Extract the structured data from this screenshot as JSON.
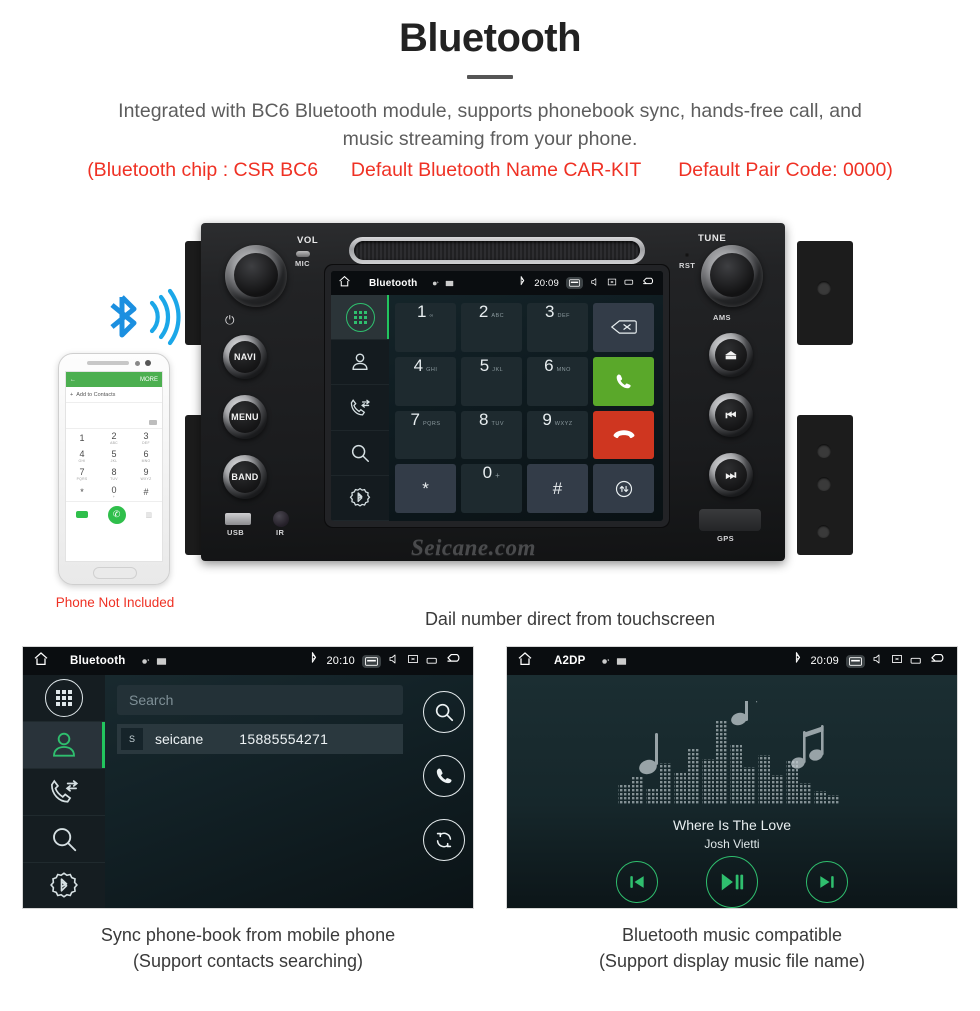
{
  "header": {
    "title": "Bluetooth",
    "subtitle_line1": "Integrated with BC6 Bluetooth module, supports phonebook sync, hands-free call, and",
    "subtitle_line2": "music streaming from your phone.",
    "note_chip": "(Bluetooth chip : CSR BC6",
    "note_name": "Default Bluetooth Name CAR-KIT",
    "note_pair": "Default Pair Code: 0000)",
    "accent_red": "#ef3124",
    "title_color": "#222222",
    "subtitle_color": "#5d5d5d"
  },
  "phone_mock": {
    "more_label": "MORE",
    "back_arrow": "←",
    "add_contacts": "Add to Contacts",
    "plus": "+",
    "keys": [
      {
        "num": "1",
        "sub": ""
      },
      {
        "num": "2",
        "sub": "ABC"
      },
      {
        "num": "3",
        "sub": "DEF"
      },
      {
        "num": "4",
        "sub": "GHI"
      },
      {
        "num": "5",
        "sub": "JKL"
      },
      {
        "num": "6",
        "sub": "MNO"
      },
      {
        "num": "7",
        "sub": "PQRS"
      },
      {
        "num": "8",
        "sub": "TUV"
      },
      {
        "num": "9",
        "sub": "WXYZ"
      },
      {
        "num": "*",
        "sub": ""
      },
      {
        "num": "0",
        "sub": "+"
      },
      {
        "num": "#",
        "sub": ""
      }
    ],
    "call_glyph": "✆",
    "not_included_label": "Phone Not Included"
  },
  "head_unit": {
    "vol_label": "VOL",
    "mic_label": "MIC",
    "power_glyph": "⏻",
    "tune_label": "TUNE",
    "rst_label": "RST",
    "ams_label": "AMS",
    "usb_label": "USB",
    "ir_label": "IR",
    "gps_label": "GPS",
    "watermark": "Seicane.com",
    "left_buttons": [
      "NAVI",
      "MENU",
      "BAND"
    ],
    "right_buttons": [
      {
        "name": "eject-button",
        "glyph": "⏏"
      },
      {
        "name": "previous-track-button",
        "glyph": "⏮"
      },
      {
        "name": "next-track-button",
        "glyph": "⏭"
      }
    ]
  },
  "main_screen": {
    "status": {
      "title": "Bluetooth",
      "time": "20:09",
      "home_icon": "home-icon",
      "bluetooth_icon": "bluetooth-icon",
      "keyboard_icon": "keyboard-icon",
      "mute_icon": "mute-icon",
      "close_icon": "close-window-icon",
      "window_icon": "window-icon",
      "back_icon": "back-arrow-icon"
    },
    "rail": [
      {
        "name": "sidebar-dialpad",
        "label": "dialpad-icon",
        "active": true
      },
      {
        "name": "sidebar-contacts",
        "label": "contacts-icon",
        "active": false
      },
      {
        "name": "sidebar-call-history",
        "label": "call-history-icon",
        "active": false
      },
      {
        "name": "sidebar-search",
        "label": "search-icon",
        "active": false
      },
      {
        "name": "sidebar-bt-settings",
        "label": "bluetooth-settings-icon",
        "active": false
      }
    ],
    "keypad": [
      {
        "type": "num",
        "num": "1",
        "sub": "∞"
      },
      {
        "type": "num",
        "num": "2",
        "sub": "ABC"
      },
      {
        "type": "num",
        "num": "3",
        "sub": "DEF"
      },
      {
        "type": "alt",
        "num": "⌫",
        "sub": "",
        "name": "backspace-key"
      },
      {
        "type": "num",
        "num": "4",
        "sub": "GHI"
      },
      {
        "type": "num",
        "num": "5",
        "sub": "JKL"
      },
      {
        "type": "num",
        "num": "6",
        "sub": "MNO"
      },
      {
        "type": "green",
        "num": "✆",
        "sub": "",
        "name": "call-key"
      },
      {
        "type": "num",
        "num": "7",
        "sub": "PQRS"
      },
      {
        "type": "num",
        "num": "8",
        "sub": "TUV"
      },
      {
        "type": "num",
        "num": "9",
        "sub": "WXYZ"
      },
      {
        "type": "red",
        "num": "✆",
        "sub": "",
        "name": "hangup-key"
      },
      {
        "type": "alt",
        "num": "*",
        "sub": "",
        "name": "star-key"
      },
      {
        "type": "num",
        "num": "0",
        "sub": "+"
      },
      {
        "type": "alt",
        "num": "#",
        "sub": "",
        "name": "hash-key"
      },
      {
        "type": "alt",
        "num": "⇅",
        "sub": "",
        "name": "transfer-audio-key"
      }
    ],
    "caption": "Dail number direct from touchscreen"
  },
  "phonebook_panel": {
    "status": {
      "title": "Bluetooth",
      "time": "20:10"
    },
    "search_placeholder": "Search",
    "contact": {
      "letter": "S",
      "name": "seicane",
      "number": "15885554271"
    },
    "actions": [
      {
        "name": "search-contacts-button",
        "glyph": "search"
      },
      {
        "name": "call-contact-button",
        "glyph": "phone"
      },
      {
        "name": "sync-contacts-button",
        "glyph": "sync"
      }
    ],
    "caption_line1": "Sync phone-book from mobile phone",
    "caption_line2": "(Support contacts searching)"
  },
  "music_panel": {
    "status": {
      "title": "A2DP",
      "time": "20:09"
    },
    "song_title": "Where Is The Love",
    "artist": "Josh Vietti",
    "controls": [
      {
        "name": "previous-button",
        "glyph": "prev"
      },
      {
        "name": "play-pause-button",
        "glyph": "playpause"
      },
      {
        "name": "next-button",
        "glyph": "next"
      }
    ],
    "accent_green": "#2fbf6e",
    "caption_line1": "Bluetooth music compatible",
    "caption_line2": "(Support display music file name)"
  }
}
